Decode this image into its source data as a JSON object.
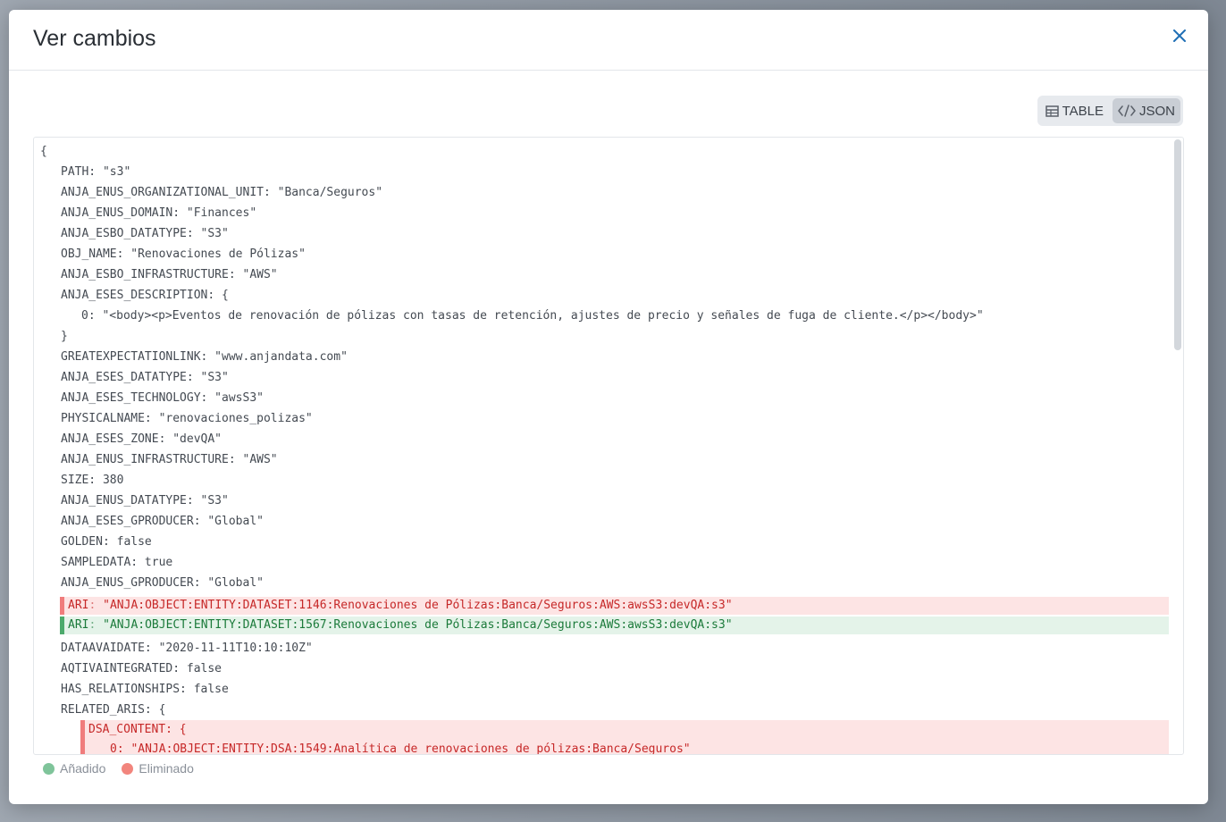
{
  "modal": {
    "title": "Ver cambios"
  },
  "view_toggle": {
    "table_label": "TABLE",
    "json_label": "JSON",
    "active": "JSON"
  },
  "json": {
    "open_brace": "{",
    "lines": [
      "PATH: \"s3\"",
      "ANJA_ENUS_ORGANIZATIONAL_UNIT: \"Banca/Seguros\"",
      "ANJA_ENUS_DOMAIN: \"Finances\"",
      "ANJA_ESBO_DATATYPE: \"S3\"",
      "OBJ_NAME: \"Renovaciones de Pólizas\"",
      "ANJA_ESBO_INFRASTRUCTURE: \"AWS\"",
      "ANJA_ESES_DESCRIPTION: {"
    ],
    "description_item": "0: \"<body><p>Eventos de renovación de pólizas con tasas de retención, ajustes de precio y señales de fuga de cliente.</p></body>\"",
    "close_brace": "}",
    "lines2": [
      "GREATEXPECTATIONLINK: \"www.anjandata.com\"",
      "ANJA_ESES_DATATYPE: \"S3\"",
      "ANJA_ESES_TECHNOLOGY: \"awsS3\"",
      "PHYSICALNAME: \"renovaciones_polizas\"",
      "ANJA_ESES_ZONE: \"devQA\"",
      "ANJA_ENUS_INFRASTRUCTURE: \"AWS\"",
      "SIZE: 380",
      "ANJA_ENUS_DATATYPE: \"S3\"",
      "ANJA_ESES_GPRODUCER: \"Global\"",
      "GOLDEN: false",
      "SAMPLEDATA: true",
      "ANJA_ENUS_GPRODUCER: \"Global\""
    ],
    "ari_removed_key": "ARI",
    "ari_removed_value": "\"ANJA:OBJECT:ENTITY:DATASET:1146:Renovaciones de Pólizas:Banca/Seguros:AWS:awsS3:devQA:s3\"",
    "ari_added_key": "ARI",
    "ari_added_value": "\"ANJA:OBJECT:ENTITY:DATASET:1567:Renovaciones de Pólizas:Banca/Seguros:AWS:awsS3:devQA:s3\"",
    "lines3": [
      "DATAAVAIDATE: \"2020-11-11T10:10:10Z\"",
      "AQTIVAINTEGRATED: false",
      "HAS_RELATIONSHIPS: false",
      "RELATED_ARIS: {"
    ],
    "dsa_key": "DSA_CONTENT",
    "dsa_brace": "{",
    "dsa_item_index": "0",
    "dsa_item_value": "\"ANJA:OBJECT:ENTITY:DSA:1549:Analítica de renovaciones de pólizas:Banca/Seguros\""
  },
  "legend": {
    "added_label": "Añadido",
    "removed_label": "Eliminado",
    "added_color": "#7fc49a",
    "removed_color": "#f2857d"
  },
  "colors": {
    "close_icon": "#1f6fb5",
    "removed_bg": "#fde4e4",
    "added_bg": "#e4f3e9"
  },
  "icons": {
    "close": "close-icon",
    "table": "table-icon",
    "json": "code-icon"
  }
}
